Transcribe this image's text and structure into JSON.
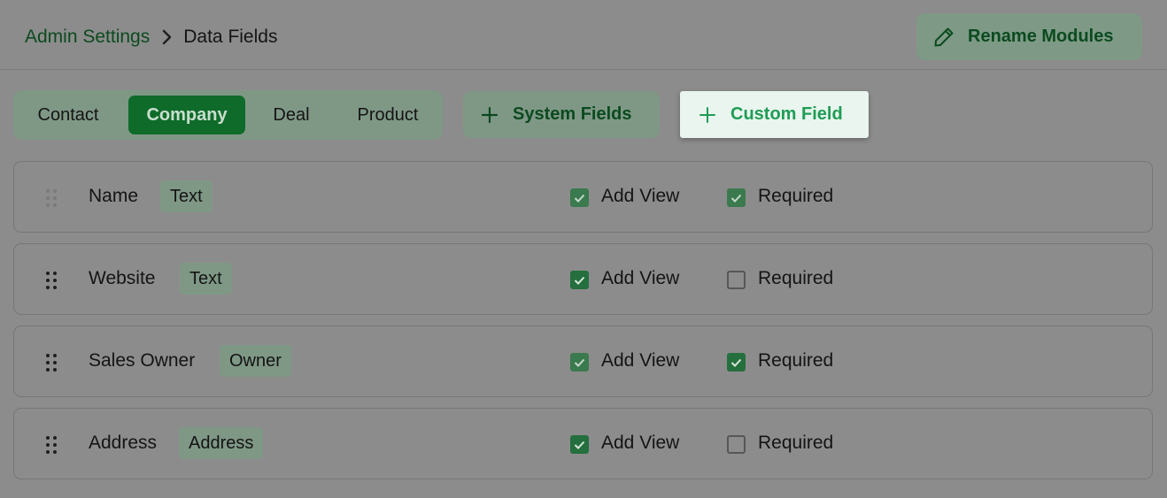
{
  "breadcrumb": {
    "parent": "Admin Settings",
    "current": "Data Fields"
  },
  "header": {
    "rename_label": "Rename Modules"
  },
  "tabs": [
    {
      "label": "Contact",
      "active": false
    },
    {
      "label": "Company",
      "active": true
    },
    {
      "label": "Deal",
      "active": false
    },
    {
      "label": "Product",
      "active": false
    }
  ],
  "actions": {
    "system_fields_label": "System Fields",
    "custom_field_label": "Custom Field"
  },
  "fields": [
    {
      "name": "Name",
      "type": "Text",
      "add_view": true,
      "required": true,
      "locked": true
    },
    {
      "name": "Website",
      "type": "Text",
      "add_view": true,
      "required": false,
      "locked": false
    },
    {
      "name": "Sales Owner",
      "type": "Owner",
      "add_view": true,
      "required": true,
      "locked": false
    },
    {
      "name": "Address",
      "type": "Address",
      "add_view": true,
      "required": false,
      "locked": false
    }
  ],
  "labels": {
    "add_view": "Add View",
    "required": "Required"
  },
  "colors": {
    "brand_green": "#0e6b2a",
    "accent_green": "#1f9c55"
  }
}
